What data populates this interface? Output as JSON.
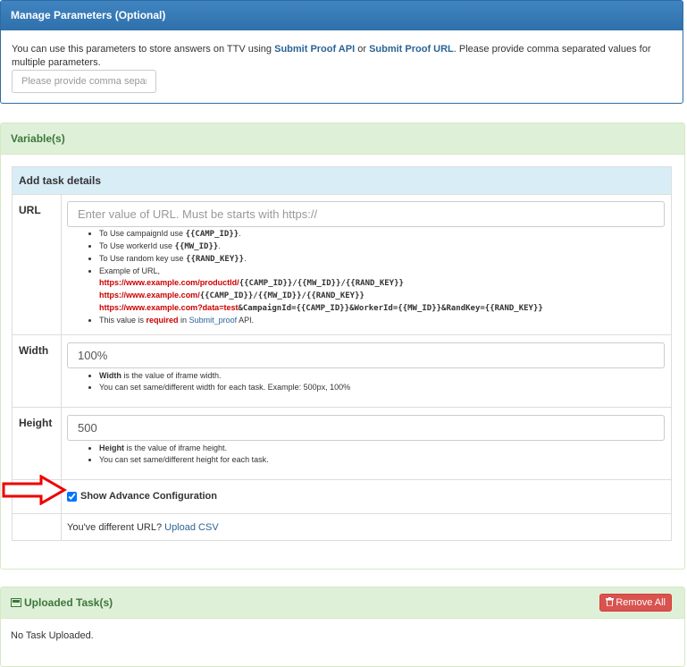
{
  "params_panel": {
    "title": "Manage Parameters (Optional)",
    "desc_pre": "You can use this parameters to store answers on TTV using ",
    "link1": "Submit Proof API",
    "desc_mid": " or ",
    "link2": "Submit Proof URL",
    "desc_post": ". Please provide comma separated values for multiple parameters.",
    "input_placeholder": "Please provide comma separated values"
  },
  "variables_panel": {
    "title": "Variable(s)",
    "table_header": "Add task details",
    "url": {
      "label": "URL",
      "placeholder": "Enter value of URL. Must be starts with https://",
      "help1_text": "To Use campaignId use ",
      "help1_code": "{{CAMP_ID}}",
      "help2_text": "To Use workerId use ",
      "help2_code": "{{MW_ID}}",
      "help3_text": "To Use random key use ",
      "help3_code": "{{RAND_KEY}}",
      "example_label": "Example of URL,",
      "ex1_red": "https://www.example.com/productId/",
      "ex1_code": "{{CAMP_ID}}/{{MW_ID}}/{{RAND_KEY}}",
      "ex2_red": "https://www.example.com/",
      "ex2_code": "{{CAMP_ID}}/{{MW_ID}}/{{RAND_KEY}}",
      "ex3_red": "https://www.example.com?data=test",
      "ex3_code": "&CampaignId={{CAMP_ID}}&WorkerId={{MW_ID}}&RandKey={{RAND_KEY}}",
      "req_pre": "This value is ",
      "req_word": "required",
      "req_mid": " in ",
      "req_link": "Submit_proof",
      "req_post": " API."
    },
    "width": {
      "label": "Width",
      "value": "100%",
      "help1_bold": "Width",
      "help1_rest": " is the value of iframe width.",
      "help2": "You can set same/different width for each task. Example: 500px, 100%"
    },
    "height": {
      "label": "Height",
      "value": "500",
      "help1_bold": "Height",
      "help1_rest": " is the value of iframe height.",
      "help2": "You can set same/different height for each task."
    },
    "advance_label": "Show Advance Configuration",
    "csv_text": "You've different URL? ",
    "csv_link": "Upload CSV"
  },
  "uploaded_panel": {
    "title": "Uploaded Task(s)",
    "remove_all": "Remove All",
    "empty_text": "No Task Uploaded."
  }
}
